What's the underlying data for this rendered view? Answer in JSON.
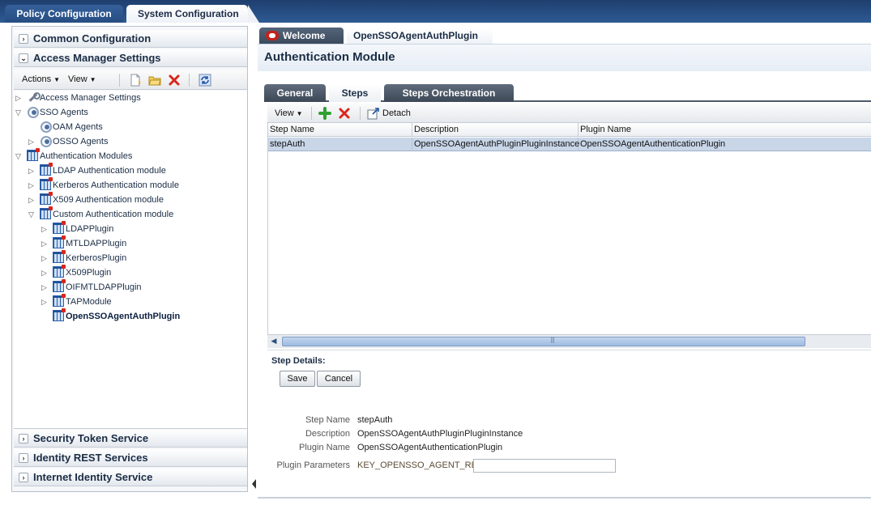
{
  "top_tabs": {
    "policy": "Policy Configuration",
    "system": "System Configuration"
  },
  "left_panel": {
    "common_configuration": "Common Configuration",
    "access_manager_settings": "Access Manager Settings",
    "security_token_service": "Security Token Service",
    "identity_rest_services": "Identity REST Services",
    "internet_identity_service": "Internet Identity Service",
    "toolbar": {
      "actions": "Actions",
      "view": "View"
    },
    "tree": [
      {
        "label": "Access Manager Settings",
        "icon": "wrench-icon",
        "expander": "▷"
      },
      {
        "label": "SSO Agents",
        "icon": "agent-icon",
        "expander": "▽"
      },
      {
        "label": "OAM Agents",
        "icon": "agent-icon",
        "expander": ""
      },
      {
        "label": "OSSO Agents",
        "icon": "agent-icon",
        "expander": "▷"
      },
      {
        "label": "Authentication Modules",
        "icon": "module-icon",
        "expander": "▽"
      },
      {
        "label": "LDAP Authentication module",
        "icon": "module-icon",
        "expander": "▷"
      },
      {
        "label": "Kerberos Authentication module",
        "icon": "module-icon",
        "expander": "▷"
      },
      {
        "label": "X509 Authentication module",
        "icon": "module-icon",
        "expander": "▷"
      },
      {
        "label": "Custom Authentication module",
        "icon": "module-icon",
        "expander": "▽"
      },
      {
        "label": "LDAPPlugin",
        "icon": "module-icon",
        "expander": "▷"
      },
      {
        "label": "MTLDAPPlugin",
        "icon": "module-icon",
        "expander": "▷"
      },
      {
        "label": "KerberosPlugin",
        "icon": "module-icon",
        "expander": "▷"
      },
      {
        "label": "X509Plugin",
        "icon": "module-icon",
        "expander": "▷"
      },
      {
        "label": "OIFMTLDAPPlugin",
        "icon": "module-icon",
        "expander": "▷"
      },
      {
        "label": "TAPModule",
        "icon": "module-icon",
        "expander": "▷"
      },
      {
        "label": "OpenSSOAgentAuthPlugin",
        "icon": "module-icon",
        "expander": "",
        "selected": true
      }
    ]
  },
  "content_tabs": {
    "welcome": "Welcome",
    "plugin": "OpenSSOAgentAuthPlugin"
  },
  "page_title": "Authentication Module",
  "sub_tabs": {
    "general": "General",
    "steps": "Steps",
    "orchestration": "Steps Orchestration"
  },
  "steps_toolbar": {
    "view": "View",
    "detach": "Detach"
  },
  "steps_table": {
    "columns": [
      "Step Name",
      "Description",
      "Plugin Name"
    ],
    "rows": [
      [
        "stepAuth",
        "OpenSSOAgentAuthPluginPluginInstance",
        "OpenSSOAgentAuthenticationPlugin"
      ]
    ]
  },
  "step_details": {
    "title": "Step Details:",
    "save": "Save",
    "cancel": "Cancel",
    "step_name_label": "Step Name",
    "step_name_value": "stepAuth",
    "description_label": "Description",
    "description_value": "OpenSSOAgentAuthPluginPluginInstance",
    "plugin_name_label": "Plugin Name",
    "plugin_name_value": "OpenSSOAgentAuthenticationPlugin",
    "plugin_params_label": "Plugin Parameters",
    "plugin_params_key": "KEY_OPENSSO_AGENT_REF",
    "plugin_params_value": ""
  },
  "colors": {
    "header_blue": "#1f3f6e",
    "selection": "#c9d6e8",
    "delete_red": "#d9261c",
    "add_green": "#2ea12e"
  }
}
